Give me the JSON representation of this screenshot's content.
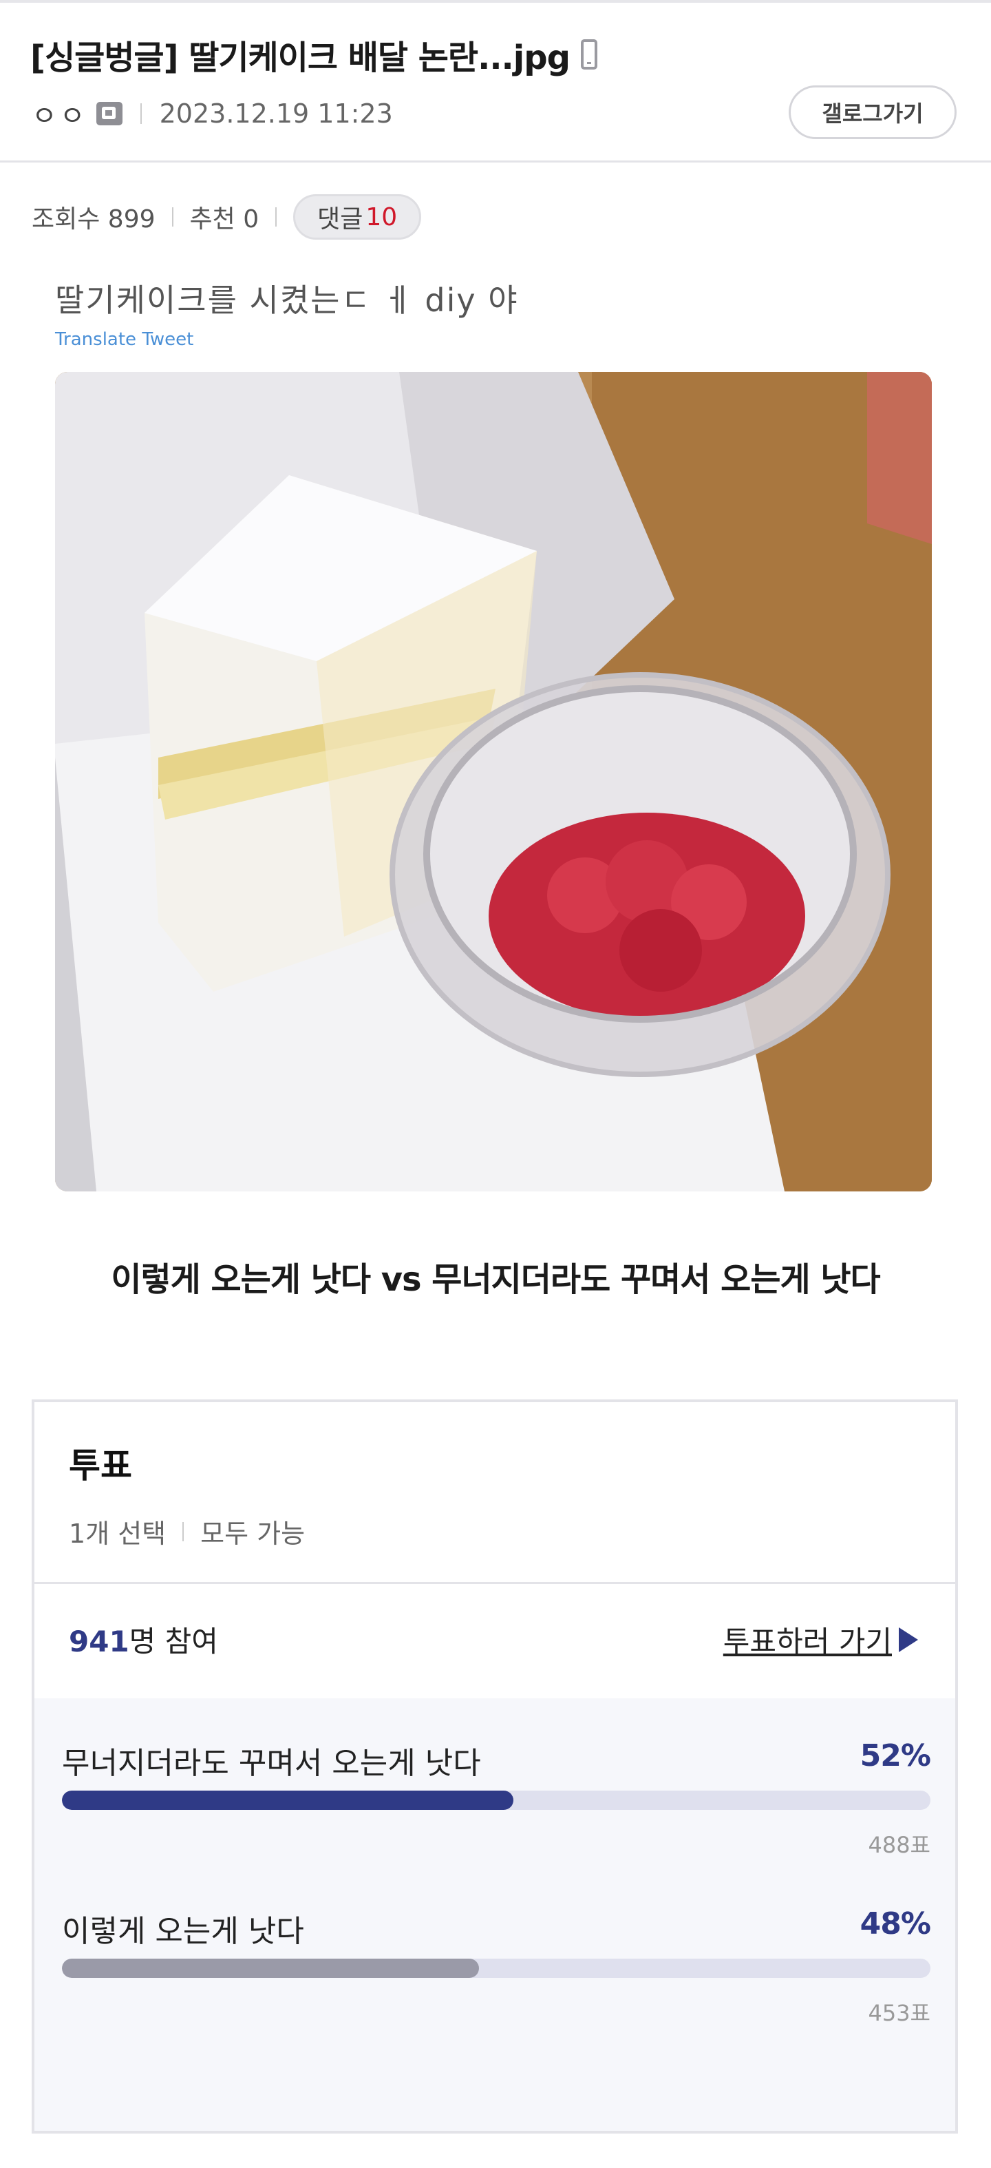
{
  "post": {
    "title": "[싱글벙글] 딸기케이크 배달 논란...jpg",
    "device_icon": "mobile-phone-icon",
    "author_nick": "ㅇㅇ",
    "author_icon": "fixed-nick-icon",
    "date": "2023.12.19 11:23",
    "gallery_button": "갤로그가기"
  },
  "stats": {
    "views": "조회수 899",
    "recommends": "추천 0",
    "comments_label": "댓글",
    "comments_count": "10"
  },
  "content": {
    "tweet_text": "딸기케이크를 시켰는ㄷ ㅔ diy 야",
    "translate_label": "Translate Tweet",
    "question": "이렇게 오는게 낫다 vs 무너지더라도 꾸며서 오는게 낫다"
  },
  "poll": {
    "title": "투표",
    "mode": "1개 선택",
    "visibility": "모두 가능",
    "participants_num": "941",
    "participants_suffix": "명 참여",
    "vote_link": "투표하러 가기",
    "options": [
      {
        "label": "무너지더라도 꾸며서 오는게 낫다",
        "percent_text": "52%",
        "percent": 52,
        "votes": "488표",
        "color": "#2f3a86"
      },
      {
        "label": "이렇게 오는게 낫다",
        "percent_text": "48%",
        "percent": 48,
        "votes": "453표",
        "color": "#9a9aa8"
      }
    ]
  },
  "colors": {
    "accent": "#2f3a86",
    "comment_count": "#d0182a",
    "link_blue": "#4a8fd6"
  }
}
